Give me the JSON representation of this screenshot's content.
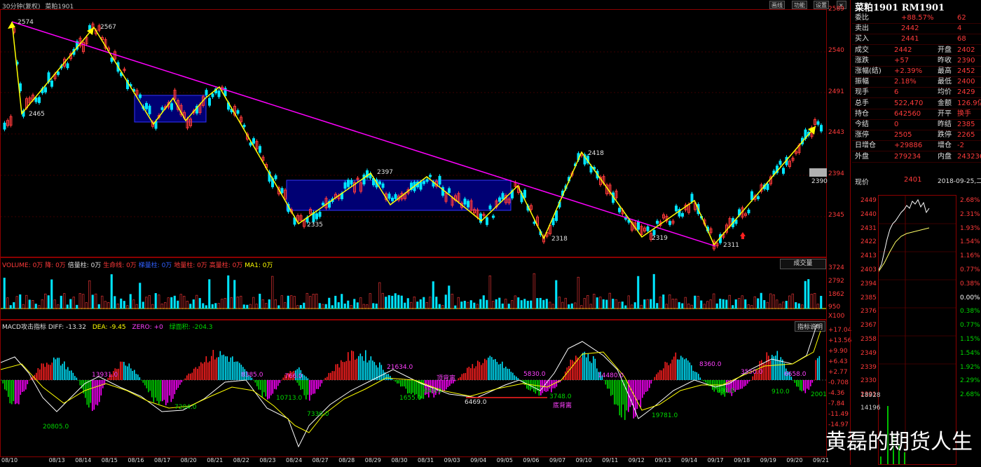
{
  "header": {
    "period": "30分钟(复权)",
    "symbol": "菜粕1901"
  },
  "top_buttons": [
    "画线",
    "功能",
    "设置"
  ],
  "price_axis": [
    "2589",
    "2540",
    "2491",
    "2443",
    "2394",
    "2345"
  ],
  "price_tag": "2390",
  "swing_labels": [
    "2574",
    "2465",
    "2567",
    "2335",
    "2397",
    "2318",
    "2418",
    "2319",
    "2311"
  ],
  "volume": {
    "title": "VOLUME: 0万",
    "items": [
      "降: 0万",
      "倍量柱: 0万",
      "生命线: 0万",
      "梯量柱: 0万",
      "地量柱: 0万",
      "高量柱: 0万",
      "MA1: 0万"
    ],
    "select": "成交量",
    "axis": [
      "3724",
      "2792",
      "1862",
      "950",
      "X100"
    ]
  },
  "macd": {
    "title": "MACD攻击指标 DIFF: -13.32",
    "dea": "DEA: -9.45",
    "zero": "ZERO: +0",
    "green": "绿面积: -204.3",
    "button": "指标说明",
    "axis": [
      "+17.04",
      "+13.56",
      "+9.90",
      "+6.43",
      "+2.77",
      "-0.708",
      "-4.36",
      "-7.84",
      "-11.49",
      "-14.97"
    ],
    "areas": [
      "13931.0",
      "8385.0",
      "766.0",
      "21634.0",
      "5830.0",
      "14480.0",
      "8360.0",
      "3550.0",
      "6658.0",
      "20805.0",
      "7204.0",
      "10713.0",
      "7330.0",
      "1655.0",
      "649.0",
      "6469.0",
      "3748.0",
      "19781.0",
      "991.0",
      "910.0",
      "2001"
    ],
    "notes": [
      "顶背离",
      "底背离"
    ]
  },
  "dates": [
    "08/10",
    "08/13",
    "08/14",
    "08/15",
    "08/16",
    "08/17",
    "08/20",
    "08/21",
    "08/22",
    "08/23",
    "08/24",
    "08/27",
    "08/28",
    "08/29",
    "08/30",
    "08/31",
    "09/03",
    "09/04",
    "09/05",
    "09/06",
    "09/07",
    "09/10",
    "09/11",
    "09/12",
    "09/13",
    "09/14",
    "09/17",
    "09/18",
    "09/19",
    "09/20",
    "09/21"
  ],
  "quote": {
    "title": "菜粕1901 RM1901",
    "rows": [
      [
        "委比",
        "+88.57%",
        "62"
      ],
      [
        "卖出",
        "2442",
        "4"
      ],
      [
        "买入",
        "2441",
        "68"
      ],
      [
        "成交",
        "2442",
        "开盘",
        "2402"
      ],
      [
        "涨跌",
        "+57",
        "昨收",
        "2390"
      ],
      [
        "涨幅(结)",
        "+2.39%",
        "最高",
        "2452"
      ],
      [
        "振幅",
        "2.18%",
        "最低",
        "2400"
      ],
      [
        "现手",
        "6",
        "均价",
        "2429"
      ],
      [
        "总手",
        "522,470",
        "金额",
        "126.9亿"
      ],
      [
        "持仓",
        "642560",
        "开平",
        "换手"
      ],
      [
        "今结",
        "0",
        "昨结",
        "2385"
      ],
      [
        "涨停",
        "2505",
        "跌停",
        "2265"
      ],
      [
        "日增仓",
        "+29886",
        "增仓",
        "-2"
      ],
      [
        "外盘",
        "279234",
        "内盘",
        "243236"
      ]
    ],
    "current_label": "现价",
    "current": "2401",
    "date": "2018-09-25,二"
  },
  "intraday": {
    "left_axis": [
      "2449",
      "2440",
      "2431",
      "2422",
      "2413",
      "2403",
      "2394",
      "2385",
      "2376",
      "2367",
      "2358",
      "2349",
      "2339",
      "2330",
      "2321",
      "18928",
      "14196"
    ],
    "right_axis": [
      "2.68%",
      "2.31%",
      "1.93%",
      "1.54%",
      "1.16%",
      "0.77%",
      "0.38%",
      "0.00%",
      "0.38%",
      "0.77%",
      "1.15%",
      "1.54%",
      "1.92%",
      "2.29%",
      "2.68%"
    ]
  },
  "watermark": "黄磊的期货人生"
}
